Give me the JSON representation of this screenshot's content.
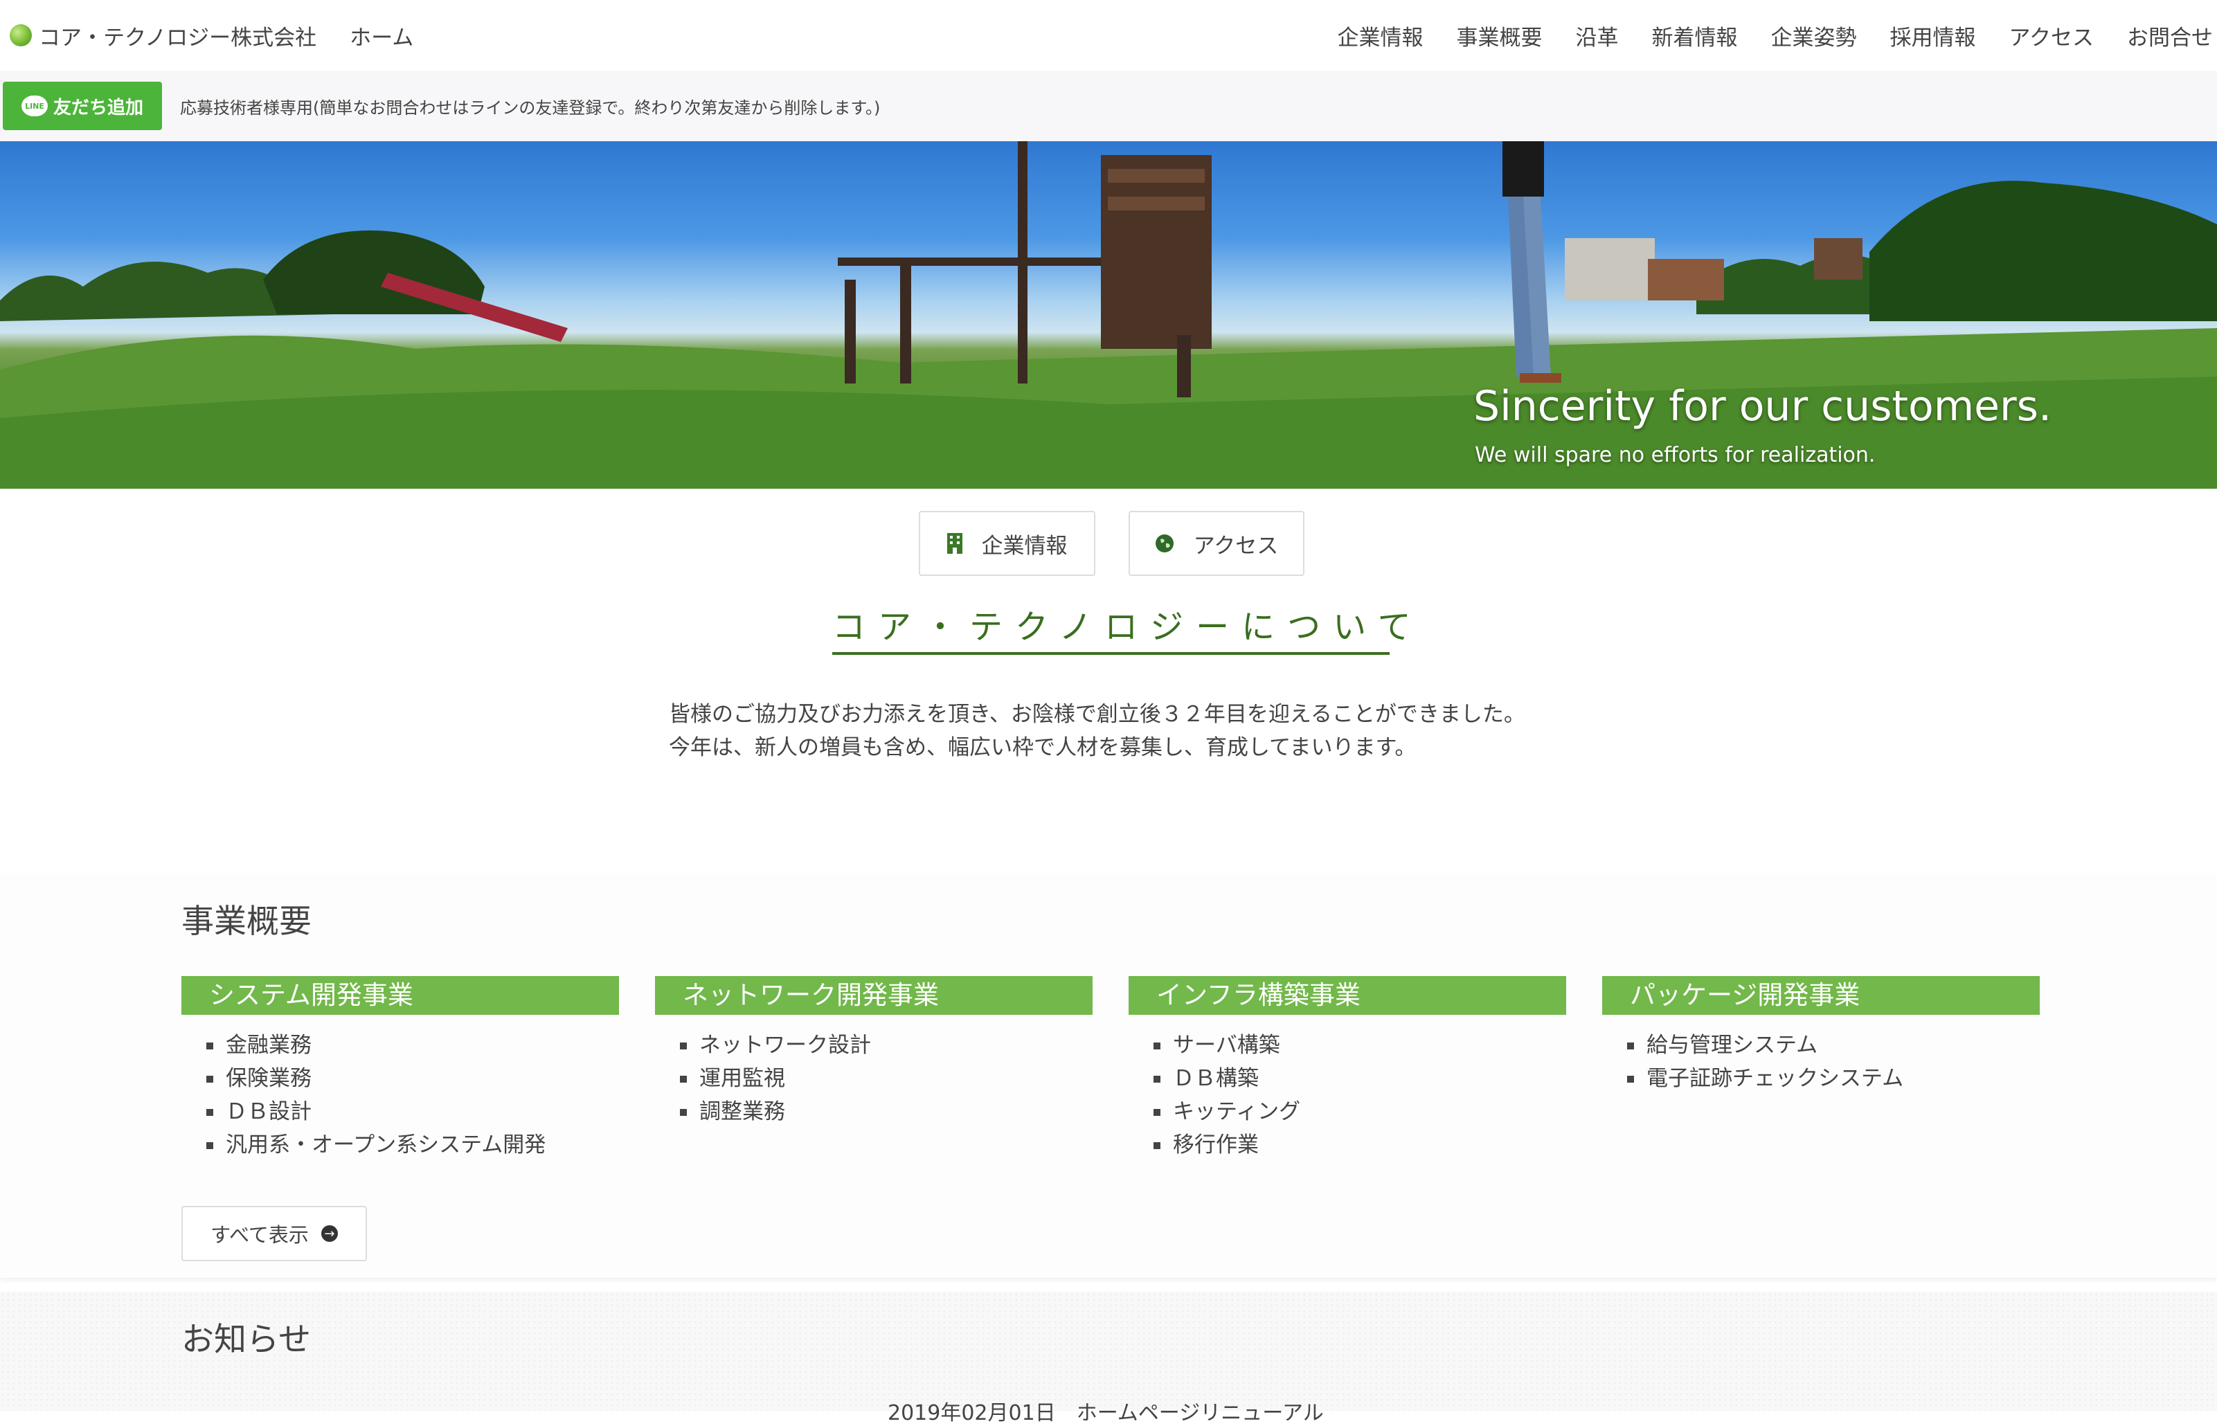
{
  "nav": {
    "brand": "コア・テクノロジー株式会社",
    "home": "ホーム",
    "items": [
      "企業情報",
      "事業概要",
      "沿革",
      "新着情報",
      "企業姿勢",
      "採用情報",
      "アクセス",
      "お問合せ"
    ]
  },
  "line_bar": {
    "button_label": "友だち追加",
    "icon_text": "LINE",
    "text": "応募技術者様専用(簡単なお問合わせはラインの友達登録で。終わり次第友達から削除します。)"
  },
  "hero": {
    "title": "Sincerity for our customers.",
    "subtitle": "We will spare no efforts for realization."
  },
  "buttons": {
    "company": "企業情報",
    "access": "アクセス"
  },
  "about": {
    "title": "コア・テクノロジーについて",
    "lines": [
      "皆様のご協力及びお力添えを頂き、お陰様で創立後３２年目を迎えることができました。",
      "今年は、新人の増員も含め、幅広い枠で人材を募集し、育成してまいります。"
    ]
  },
  "business": {
    "title": "事業概要",
    "cards": [
      {
        "title": "システム開発事業",
        "items": [
          "金融業務",
          "保険業務",
          "ＤＢ設計",
          "汎用系・オープン系システム開発"
        ]
      },
      {
        "title": "ネットワーク開発事業",
        "items": [
          "ネットワーク設計",
          "運用監視",
          "調整業務"
        ]
      },
      {
        "title": "インフラ構築事業",
        "items": [
          "サーバ構築",
          "ＤＢ構築",
          "キッティング",
          "移行作業"
        ]
      },
      {
        "title": "パッケージ開発事業",
        "items": [
          "給与管理システム",
          "電子証跡チェックシステム"
        ]
      }
    ],
    "show_all": "すべて表示"
  },
  "news": {
    "title": "お知らせ",
    "first_item": "2019年02月01日　ホームページリニューアル"
  },
  "colors": {
    "accent_green": "#72b84a",
    "line_green": "#4cb43a",
    "about_title": "#3a6e1f"
  }
}
